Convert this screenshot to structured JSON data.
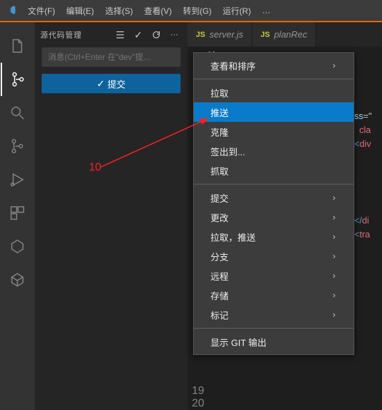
{
  "menubar": {
    "items": [
      "文件(F)",
      "编辑(E)",
      "选择(S)",
      "查看(V)",
      "转到(G)",
      "运行(R)",
      "…"
    ]
  },
  "sidebar": {
    "title": "源代码管理",
    "commit_placeholder": "消息(Ctrl+Enter 在\"dev\"提...",
    "commit_btn": "提交"
  },
  "tabs": {
    "items": [
      "server.js",
      "planRec"
    ]
  },
  "breadcrumb": "s > M",
  "annotation": "10",
  "ctx": {
    "items": [
      {
        "label": "查看和排序",
        "sub": true
      },
      {
        "sep": true
      },
      {
        "label": "拉取"
      },
      {
        "label": "推送",
        "hl": true
      },
      {
        "label": "克隆"
      },
      {
        "label": "签出到..."
      },
      {
        "label": "抓取"
      },
      {
        "sep": true
      },
      {
        "label": "提交",
        "sub": true
      },
      {
        "label": "更改",
        "sub": true
      },
      {
        "label": "拉取，推送",
        "sub": true
      },
      {
        "label": "分支",
        "sub": true
      },
      {
        "label": "远程",
        "sub": true
      },
      {
        "label": "存储",
        "sub": true
      },
      {
        "label": "标记",
        "sub": true
      },
      {
        "sep": true
      },
      {
        "label": "显示 GIT 输出"
      }
    ]
  },
  "code": {
    "lines": [
      {
        "n": "",
        "frags": [
          {
            "t": "ss",
            "c": "token-attr"
          },
          {
            "t": "=\"",
            "c": ""
          }
        ]
      },
      {
        "n": "",
        "frags": [
          {
            "t": "  cla",
            "c": "token-red"
          }
        ]
      },
      {
        "n": "",
        "frags": [
          {
            "t": "<",
            "c": "token-tag"
          },
          {
            "t": "div",
            "c": "token-red"
          }
        ]
      },
      {
        "n": "",
        "frags": []
      },
      {
        "n": "",
        "frags": []
      },
      {
        "n": "",
        "frags": []
      },
      {
        "n": "",
        "frags": [
          {
            "t": "</",
            "c": "token-tag"
          },
          {
            "t": "di",
            "c": "token-red"
          }
        ]
      },
      {
        "n": "",
        "frags": [
          {
            "t": "<",
            "c": "token-tag"
          },
          {
            "t": "tra",
            "c": "token-red"
          }
        ]
      }
    ],
    "bottomLines": [
      "19",
      "20"
    ]
  }
}
